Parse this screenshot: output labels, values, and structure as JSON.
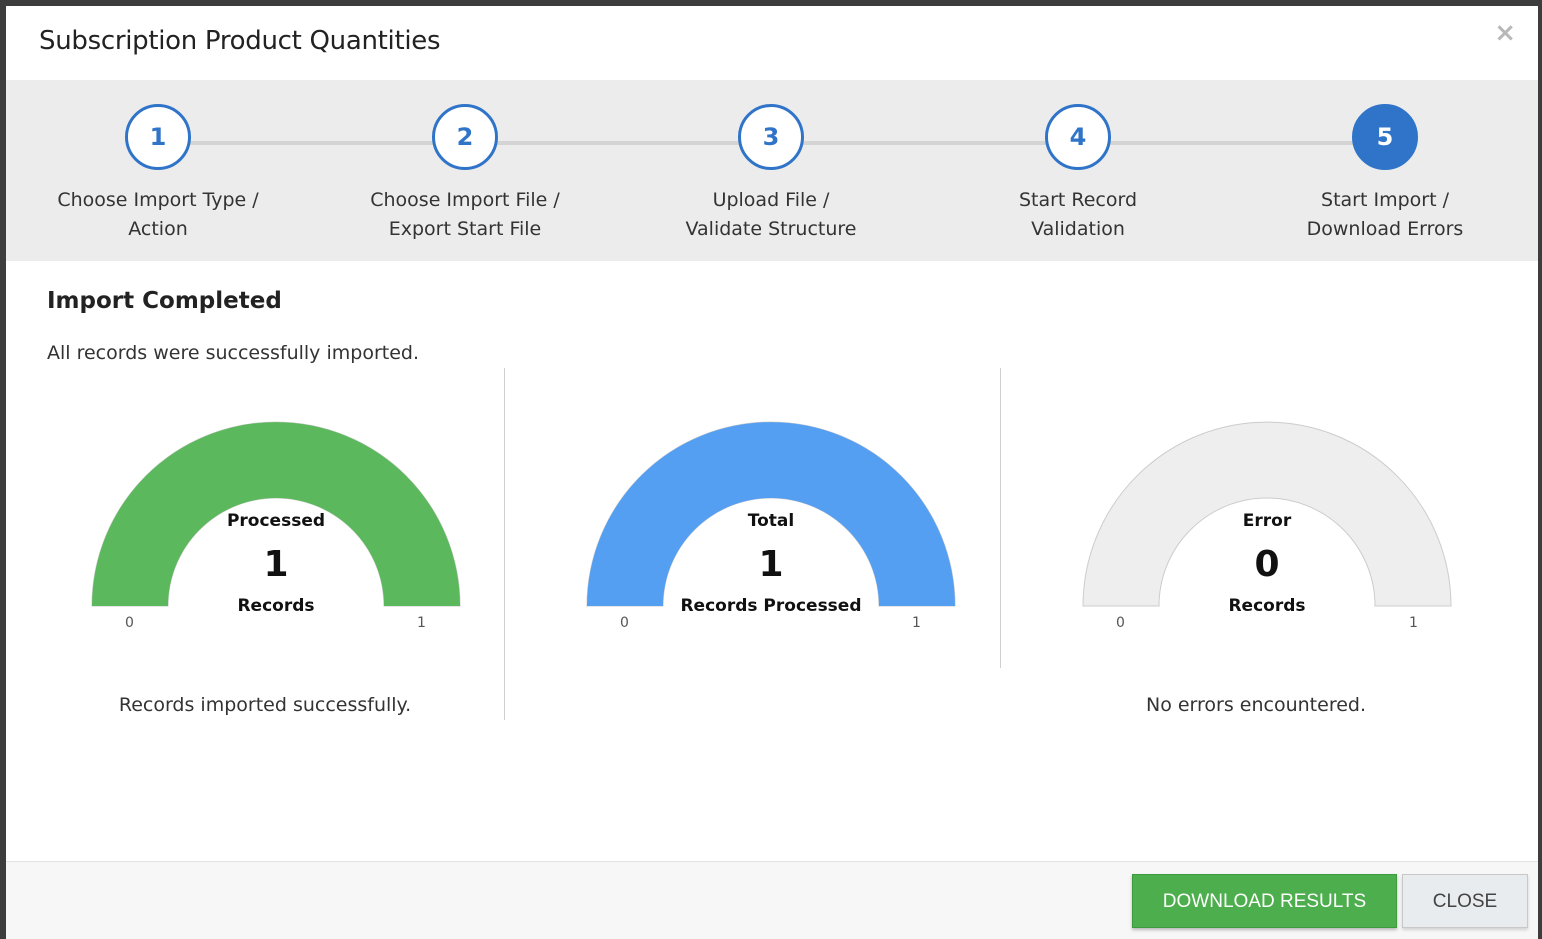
{
  "dialog": {
    "title": "Subscription Product Quantities",
    "close_icon": "close-icon"
  },
  "wizard": {
    "steps": [
      {
        "number": "1",
        "label": "Choose Import Type /\nAction",
        "active": false
      },
      {
        "number": "2",
        "label": "Choose Import File /\nExport Start File",
        "active": false
      },
      {
        "number": "3",
        "label": "Upload File /\nValidate Structure",
        "active": false
      },
      {
        "number": "4",
        "label": "Start Record\nValidation",
        "active": false
      },
      {
        "number": "5",
        "label": "Start Import /\nDownload Errors",
        "active": true
      }
    ]
  },
  "content": {
    "title": "Import Completed",
    "description": "All records were successfully imported."
  },
  "gauges": [
    {
      "title": "Processed",
      "value": "1",
      "unit": "Records",
      "min": "0",
      "max": "1",
      "fraction": 1,
      "color": "#5cb85c",
      "caption": "Records imported successfully."
    },
    {
      "title": "Total",
      "value": "1",
      "unit": "Records Processed",
      "min": "0",
      "max": "1",
      "fraction": 1,
      "color": "#559ff2",
      "caption": ""
    },
    {
      "title": "Error",
      "value": "0",
      "unit": "Records",
      "min": "0",
      "max": "1",
      "fraction": 0,
      "color": "#eeeeee",
      "caption": "No errors encountered."
    }
  ],
  "footer": {
    "download_label": "DOWNLOAD RESULTS",
    "close_label": "CLOSE"
  },
  "colors": {
    "accent": "#2f74c8",
    "success": "#5cb85c",
    "info": "#559ff2"
  }
}
